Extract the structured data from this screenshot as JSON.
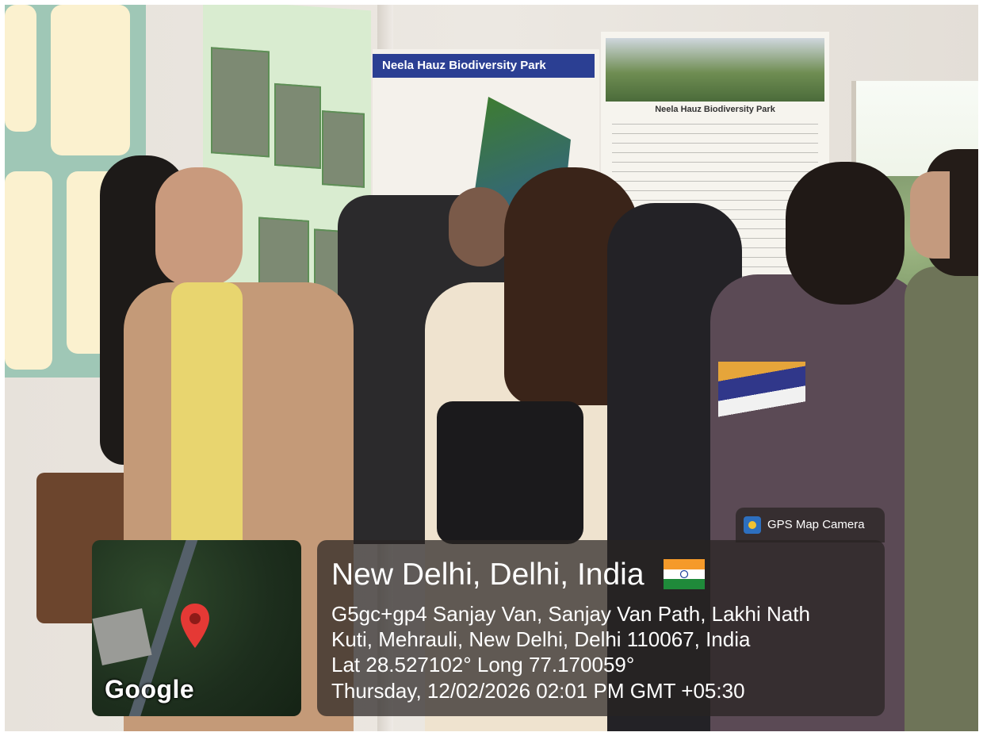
{
  "photo": {
    "description_hidden": ""
  },
  "background_poster": {
    "title": "Neela Hauz Biodiversity Park",
    "accent_color": "#2b3f93"
  },
  "gps_overlay": {
    "badge_label": "GPS Map Camera",
    "map_brand": "Google",
    "location_title": "New Delhi, Delhi, India",
    "address_line1": "G5gc+gp4 Sanjay Van, Sanjay Van Path, Lakhi Nath",
    "address_line2": "Kuti, Mehrauli, New Delhi, Delhi 110067, India",
    "lat_long": "Lat 28.527102° Long 77.170059°",
    "datetime": "Thursday, 12/02/2026 02:01 PM GMT +05:30",
    "flag_icon": "india-flag-icon",
    "pin_icon": "location-pin-icon",
    "pin_color": "#e53935"
  }
}
